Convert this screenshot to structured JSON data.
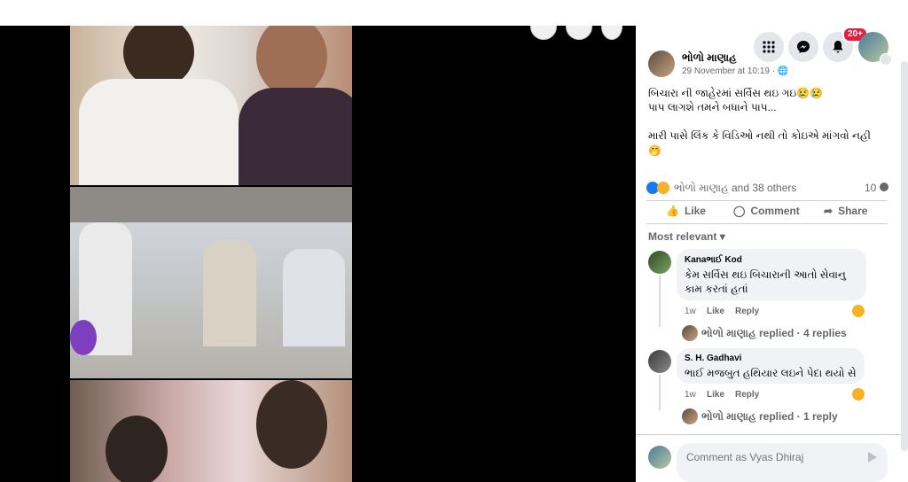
{
  "header": {
    "notification_count": "20+"
  },
  "post": {
    "author": "ભોળો માણાહ",
    "timestamp": "29 November at 10:19 · ",
    "text_line1": "બિચારા ની જાહેરમાં સર્વિસ થઇ ગઇ😢😢",
    "text_line2": "પાપ લાગશે તમને બધાને પાપ...",
    "text_line3": "મારી પાસે લિંક કે વિડિઓ નથી તો કોઇએ માંગવો નહી",
    "text_line4": "🤭",
    "reactions_text": "ભોળો માણાહ and 38 others",
    "comments_count": "10",
    "like_label": "Like",
    "comment_label": "Comment",
    "share_label": "Share",
    "sort_label": "Most relevant"
  },
  "comments": [
    {
      "author": "Kanaભાઈ Kod",
      "text_line1": "કેમ સર્વિસ થઇ બિચારાની આતો સેવાનુ",
      "text_line2": "કામ કરતાં હતાં",
      "time": "1w",
      "like": "Like",
      "reply": "Reply",
      "replies_text": "ભોળો માણાહ replied · 4 replies"
    },
    {
      "author": "S. H. Gadhavi",
      "text_line1": "ભાઈ મજબુત હથિયાર લઇને પેદા થયો સે",
      "time": "1w",
      "like": "Like",
      "reply": "Reply",
      "replies_text": "ભોળો માણાહ replied · 1 reply"
    }
  ],
  "composer": {
    "placeholder": "Comment as Vyas Dhiraj"
  },
  "colors": {
    "accent": "#1877f2",
    "badge": "#e41e3f",
    "muted": "#65676b"
  }
}
